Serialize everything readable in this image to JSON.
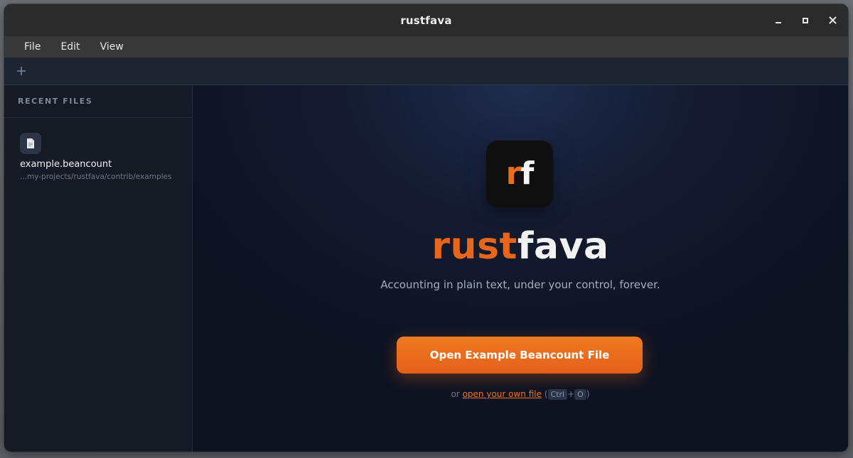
{
  "window": {
    "title": "rustfava",
    "controls": [
      "minimize",
      "maximize",
      "close"
    ]
  },
  "menubar": {
    "items": [
      "File",
      "Edit",
      "View"
    ]
  },
  "tabbar": {
    "add_tab_label": "+"
  },
  "sidebar": {
    "header": "RECENT FILES",
    "recent_files": [
      {
        "name": "example.beancount",
        "path": "...my-projects/rustfava/contrib/examples",
        "icon": "file-icon"
      }
    ]
  },
  "main": {
    "logo": {
      "r": "r",
      "f": "f"
    },
    "brand": {
      "part1": "rust",
      "part2": "fava"
    },
    "tagline": "Accounting in plain text, under your control, forever.",
    "open_example_button": "Open Example Beancount File",
    "alt_prefix": "or",
    "open_own_link": "open your own file",
    "shortcut_open": "(",
    "shortcut_keys": [
      "Ctrl",
      "O"
    ],
    "shortcut_plus": "+",
    "shortcut_close": ")"
  },
  "colors": {
    "accent": "#e8661c",
    "background": "#131722",
    "sidebar": "#151a24"
  }
}
